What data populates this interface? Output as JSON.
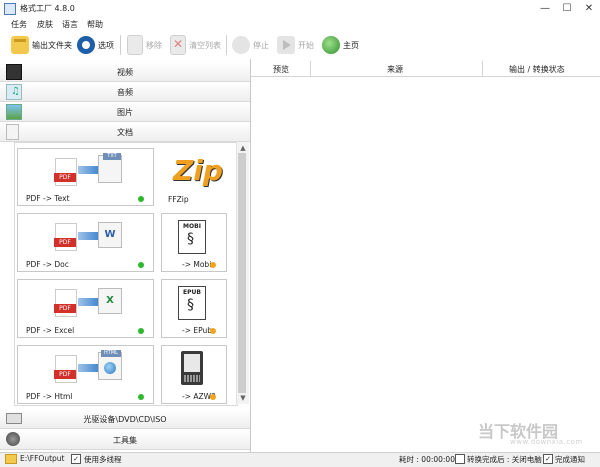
{
  "window": {
    "title": "格式工厂 4.8.0",
    "min": "—",
    "max": "☐",
    "close": "✕"
  },
  "menu": [
    "任务",
    "皮肤",
    "语言",
    "帮助"
  ],
  "toolbar": {
    "output_folder": "输出文件夹",
    "options": "选项",
    "remove": "移除",
    "clear_list": "清空列表",
    "stop": "停止",
    "start": "开始",
    "home": "主页"
  },
  "categories": {
    "video": "视频",
    "audio": "音频",
    "image": "图片",
    "document": "文档"
  },
  "tiles": {
    "pdf_text": "PDF -> Text",
    "ffzip": "FFZip",
    "pdf_doc": "PDF -> Doc",
    "mobi": "-> Mobi",
    "pdf_excel": "PDF -> Excel",
    "epub": "-> EPub",
    "pdf_html": "PDF -> Html",
    "azw3": "-> AZW3",
    "icon_text_txt": "TXT",
    "icon_text_mobi": "MOBI",
    "icon_text_epub": "EPUB",
    "icon_text_html": "HTML",
    "icon_text_w": "W",
    "icon_text_x": "X",
    "icon_text_pdf": "PDF"
  },
  "bottom_categories": {
    "optical": "光驱设备\\DVD\\CD\\ISO",
    "tools": "工具集"
  },
  "grid": {
    "preview": "预览",
    "source": "来源",
    "output_status": "输出 / 转换状态"
  },
  "statusbar": {
    "output_path": "E:\\FFOutput",
    "multithread": "使用多线程",
    "elapsed": "耗时 : 00:00:00",
    "after_done": "转换完成后 : 关闭电脑",
    "notify": "完成通知"
  },
  "watermark": {
    "main": "当下软件园",
    "sub": "www.downxia.com"
  },
  "colors": {
    "green_dot": "#2db82d",
    "orange_dot": "#f2a51a",
    "pdf_red": "#d2302a",
    "accent_blue": "#2b78c5"
  }
}
